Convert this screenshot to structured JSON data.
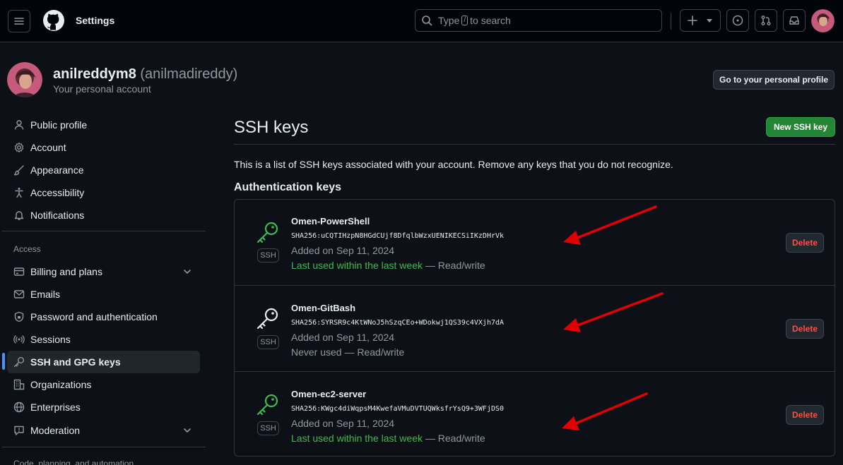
{
  "header": {
    "title": "Settings",
    "search_prefix": "Type",
    "search_key": "/",
    "search_suffix": "to search"
  },
  "account": {
    "username": "anilreddym8",
    "handle": "(anilmadireddy)",
    "subtitle": "Your personal account",
    "profile_button": "Go to your personal profile"
  },
  "sidebar": {
    "items": [
      {
        "label": "Public profile",
        "icon": "person-icon"
      },
      {
        "label": "Account",
        "icon": "gear-icon"
      },
      {
        "label": "Appearance",
        "icon": "paintbrush-icon"
      },
      {
        "label": "Accessibility",
        "icon": "accessibility-icon"
      },
      {
        "label": "Notifications",
        "icon": "bell-icon"
      }
    ],
    "access_group": "Access",
    "access_items": [
      {
        "label": "Billing and plans",
        "icon": "credit-card-icon"
      },
      {
        "label": "Emails",
        "icon": "mail-icon"
      },
      {
        "label": "Password and authentication",
        "icon": "shield-lock-icon"
      },
      {
        "label": "Sessions",
        "icon": "broadcast-icon"
      },
      {
        "label": "SSH and GPG keys",
        "icon": "key-icon"
      },
      {
        "label": "Organizations",
        "icon": "organization-icon"
      },
      {
        "label": "Enterprises",
        "icon": "globe-icon"
      },
      {
        "label": "Moderation",
        "icon": "report-icon"
      }
    ],
    "next_group": "Code, planning, and automation"
  },
  "main": {
    "title": "SSH keys",
    "new_button": "New SSH key",
    "description": "This is a list of SSH keys associated with your account. Remove any keys that you do not recognize.",
    "subhead": "Authentication keys",
    "badge": "SSH",
    "delete_label": "Delete",
    "keys": [
      {
        "name": "Omen-PowerShell",
        "fingerprint": "SHA256:uCQTIHzpN8HGdCUjf8DfqlbWzxUENIKECSiIKzDHrVk",
        "added": "Added on Sep 11, 2024",
        "used": "Last used within the last week",
        "access": "— Read/write"
      },
      {
        "name": "Omen-GitBash",
        "fingerprint": "SHA256:SYRSR9c4KtWNoJ5hSzqCEo+WDokwj1QS39c4VXjh7dA",
        "added": "Added on Sep 11, 2024",
        "used": "Never used",
        "access": "— Read/write"
      },
      {
        "name": "Omen-ec2-server",
        "fingerprint": "SHA256:KWgc4diWqpsM4KwefaVMuDVTUQWksfrYsQ9+3WFjDS0",
        "added": "Added on Sep 11, 2024",
        "used": "Last used within the last week",
        "access": "— Read/write"
      }
    ]
  },
  "colors": {
    "accent_green": "#238636",
    "recent_green": "#3fb950",
    "danger": "#f85149",
    "active_blue": "#4493f8",
    "annotation_red": "#e00000"
  }
}
